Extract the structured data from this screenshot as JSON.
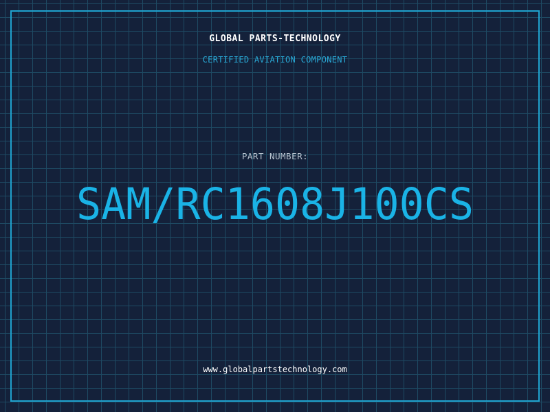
{
  "header": {
    "brand": "GLOBAL PARTS-TECHNOLOGY",
    "tagline": "CERTIFIED AVIATION COMPONENT"
  },
  "main": {
    "part_label": "PART NUMBER:",
    "part_number": "SAM/RC1608J100CS"
  },
  "footer": {
    "website": "www.globalpartstechnology.com"
  },
  "colors": {
    "background": "#14213a",
    "grid": "#1e4a63",
    "frame": "#1fa3cf",
    "accent": "#1ab3e6",
    "label": "#b8c4d0",
    "text": "#ffffff"
  }
}
